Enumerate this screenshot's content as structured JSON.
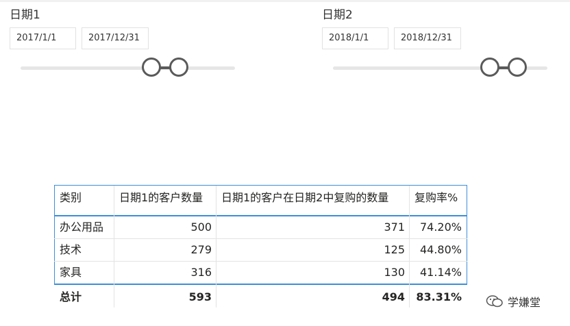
{
  "slicers": [
    {
      "title": "日期1",
      "start": "2017/1/1",
      "end": "2017/12/31"
    },
    {
      "title": "日期2",
      "start": "2018/1/1",
      "end": "2018/12/31"
    }
  ],
  "table": {
    "headers": [
      "类别",
      "日期1的客户数量",
      "日期1的客户在日期2中复购的数量",
      "复购率%"
    ],
    "rows": [
      [
        "办公用品",
        "500",
        "371",
        "74.20%"
      ],
      [
        "技术",
        "279",
        "125",
        "44.80%"
      ],
      [
        "家具",
        "316",
        "130",
        "41.14%"
      ]
    ],
    "total": [
      "总计",
      "593",
      "494",
      "83.31%"
    ]
  },
  "watermark": {
    "text": "学嫌堂",
    "icon": "wechat-icon"
  }
}
